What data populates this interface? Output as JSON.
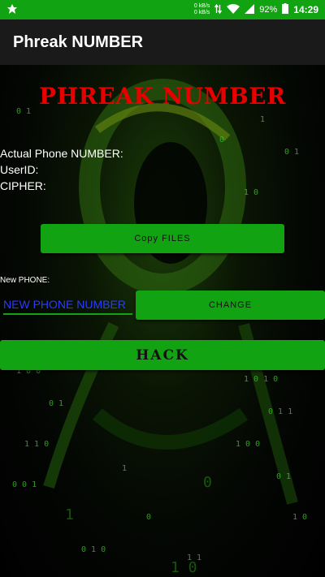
{
  "status_bar": {
    "net_speed_up": "0 kB/s",
    "net_speed_down": "0 kB/s",
    "battery": "92%",
    "time": "14:29"
  },
  "app_bar": {
    "title": "Phreak NUMBER"
  },
  "main": {
    "headline": "PHREAK NUMBER",
    "actual_phone_label": "Actual Phone NUMBER:",
    "userid_label": "UserID:",
    "cipher_label": "CIPHER:",
    "copy_button": "Copy FILES",
    "new_phone_label": "New PHONE:",
    "new_phone_placeholder": "NEW PHONE NUMBER",
    "change_button": "CHANGE",
    "hack_button": "HACK"
  },
  "colors": {
    "accent_green": "#12a312",
    "headline_red": "#e60000",
    "input_text_blue": "#2a3bff"
  }
}
